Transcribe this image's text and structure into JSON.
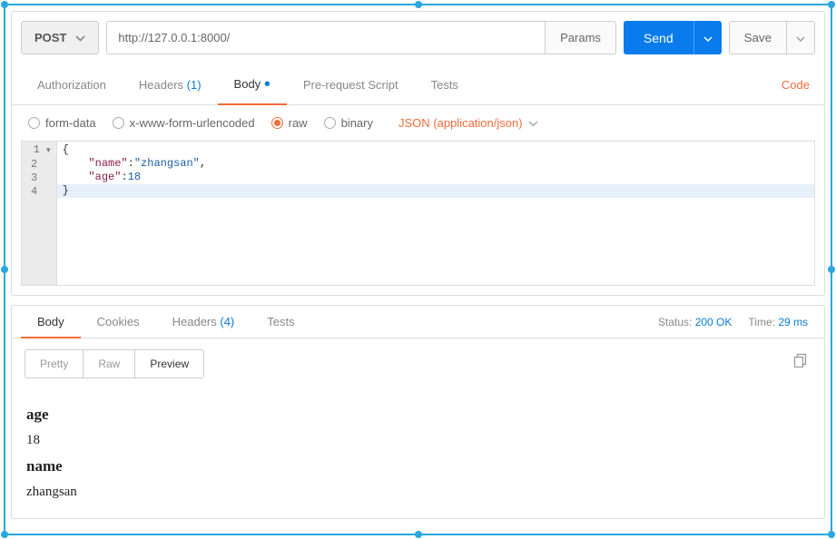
{
  "request": {
    "method": "POST",
    "url": "http://127.0.0.1:8000/",
    "params_label": "Params",
    "send_label": "Send",
    "save_label": "Save"
  },
  "request_tabs": {
    "authorization": "Authorization",
    "headers_label": "Headers",
    "headers_count": "(1)",
    "body": "Body",
    "prerequest": "Pre-request Script",
    "tests": "Tests",
    "code_link": "Code"
  },
  "body_type": {
    "form_data": "form-data",
    "urlencoded": "x-www-form-urlencoded",
    "raw": "raw",
    "binary": "binary",
    "content_type": "JSON (application/json)"
  },
  "editor": {
    "gutter": [
      "1",
      "2",
      "3",
      "4"
    ],
    "fold_marker_at": 0,
    "body_json": {
      "name": "zhangsan",
      "age": 18
    }
  },
  "response_tabs": {
    "body": "Body",
    "cookies": "Cookies",
    "headers_label": "Headers",
    "headers_count": "(4)",
    "tests": "Tests"
  },
  "status": {
    "status_label": "Status:",
    "status_value": "200 OK",
    "time_label": "Time:",
    "time_value": "29 ms"
  },
  "view_modes": {
    "pretty": "Pretty",
    "raw": "Raw",
    "preview": "Preview"
  },
  "preview": {
    "h1": "age",
    "v1": "18",
    "h2": "name",
    "v2": "zhangsan"
  }
}
